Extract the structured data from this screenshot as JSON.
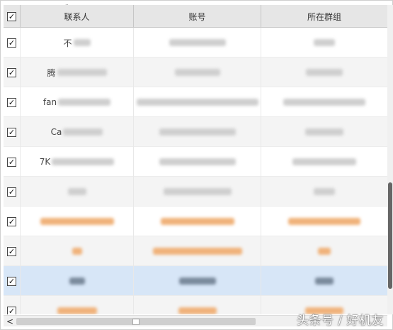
{
  "header": {
    "columns": [
      {
        "label": "联系人"
      },
      {
        "label": "账号"
      },
      {
        "label": "所在群组"
      }
    ],
    "select_all_checked": "✓"
  },
  "rows": [
    {
      "checked": "✓",
      "name_visible": "不",
      "name_blur_w": 24,
      "acct_blur_w": 80,
      "group_blur_w": 30,
      "style": "normal"
    },
    {
      "checked": "✓",
      "name_visible": "腾",
      "name_blur_w": 70,
      "acct_blur_w": 64,
      "group_blur_w": 52,
      "style": "alt"
    },
    {
      "checked": "✓",
      "name_visible": "fan",
      "name_blur_w": 74,
      "acct_blur_w": 172,
      "group_blur_w": 116,
      "style": "normal"
    },
    {
      "checked": "✓",
      "name_visible": "Ca",
      "name_blur_w": 56,
      "acct_blur_w": 108,
      "group_blur_w": 54,
      "style": "alt"
    },
    {
      "checked": "✓",
      "name_visible": "7K",
      "name_blur_w": 88,
      "acct_blur_w": 108,
      "group_blur_w": 90,
      "style": "normal"
    },
    {
      "checked": "✓",
      "name_visible": "",
      "name_blur_w": 26,
      "acct_blur_w": 96,
      "group_blur_w": 30,
      "style": "alt"
    },
    {
      "checked": "✓",
      "name_visible": "",
      "name_blur_w": 104,
      "acct_blur_w": 104,
      "group_blur_w": 102,
      "style": "orange"
    },
    {
      "checked": "✓",
      "name_visible": "",
      "name_blur_w": 14,
      "acct_blur_w": 126,
      "group_blur_w": 18,
      "style": "alt orange"
    },
    {
      "checked": "✓",
      "name_visible": "",
      "name_blur_w": 22,
      "acct_blur_w": 52,
      "group_blur_w": 26,
      "style": "selected"
    },
    {
      "checked": "✓",
      "name_visible": "",
      "name_blur_w": 56,
      "acct_blur_w": 54,
      "group_blur_w": 54,
      "style": "alt orange"
    }
  ],
  "scrollbar": {
    "left_arrow": "<",
    "vertical_position": 0.6,
    "horizontal_position": 0.0
  },
  "watermark": {
    "text": "头条号 / 好机友"
  },
  "colors": {
    "header_bg": "#e6e6e6",
    "alt_row_bg": "#f4f4f4",
    "selected_row_bg": "#d7e6f7",
    "highlight_text": "#e8974a"
  }
}
